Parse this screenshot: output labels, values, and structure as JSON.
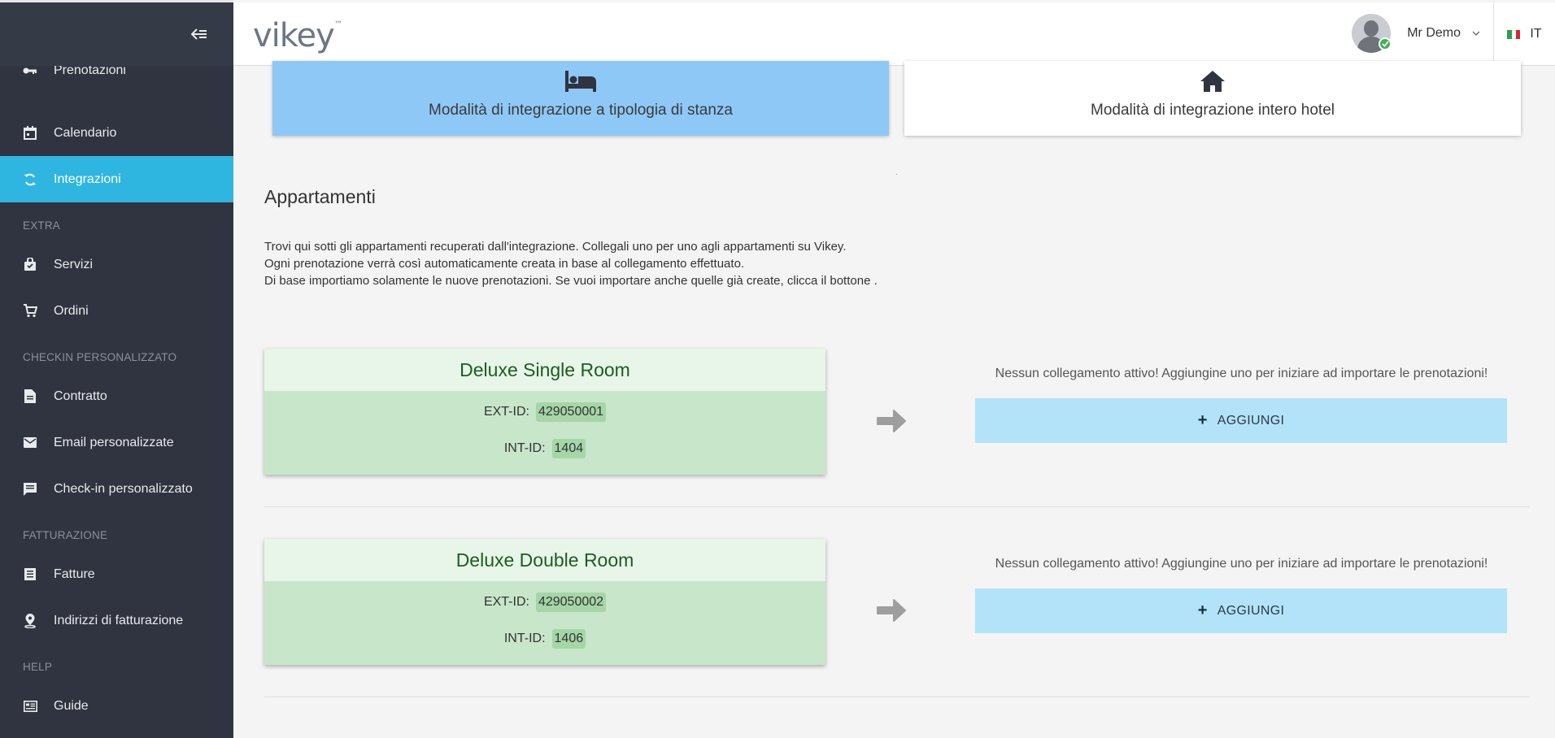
{
  "sidebar": {
    "items": [
      {
        "label": "Prenotazioni",
        "icon": "key-icon"
      },
      {
        "label": "Calendario",
        "icon": "calendar-icon"
      },
      {
        "label": "Integrazioni",
        "icon": "sync-icon",
        "active": true
      }
    ],
    "sections": [
      {
        "title": "EXTRA",
        "items": [
          {
            "label": "Servizi",
            "icon": "bag-icon"
          },
          {
            "label": "Ordini",
            "icon": "cart-icon"
          }
        ]
      },
      {
        "title": "CHECKIN PERSONALIZZATO",
        "items": [
          {
            "label": "Contratto",
            "icon": "document-icon"
          },
          {
            "label": "Email personalizzate",
            "icon": "mail-icon"
          },
          {
            "label": "Check-in personalizzato",
            "icon": "comment-icon"
          }
        ]
      },
      {
        "title": "FATTURAZIONE",
        "items": [
          {
            "label": "Fatture",
            "icon": "invoice-icon"
          },
          {
            "label": "Indirizzi di fatturazione",
            "icon": "location-icon"
          }
        ]
      },
      {
        "title": "HELP",
        "items": [
          {
            "label": "Guide",
            "icon": "guide-icon"
          }
        ]
      }
    ]
  },
  "header": {
    "logo": "vikey",
    "logo_tm": "™",
    "user_name": "Mr Demo",
    "lang": "IT"
  },
  "modes": {
    "room_type": "Modalità di integrazione a tipologia di stanza",
    "whole_hotel": "Modalità di integrazione intero hotel"
  },
  "section": {
    "title": "Appartamenti",
    "desc_lines": [
      "Trovi qui sotti gli appartamenti recuperati dall'integrazione. Collegali uno per uno agli appartamenti su Vikey.",
      "Ogni prenotazione verrà così automaticamente creata in base al collegamento effettuato.",
      "Di base importiamo solamente le nuove prenotazioni. Se vuoi importare anche quelle già create, clicca il bottone ."
    ]
  },
  "rooms": [
    {
      "name": "Deluxe Single Room",
      "ext_label": "EXT-ID:",
      "ext_id": "429050001",
      "int_label": "INT-ID:",
      "int_id": "1404",
      "status": "Nessun collegamento attivo! Aggiungine uno per iniziare ad importare le prenotazioni!",
      "button": "AGGIUNGI"
    },
    {
      "name": "Deluxe Double Room",
      "ext_label": "EXT-ID:",
      "ext_id": "429050002",
      "int_label": "INT-ID:",
      "int_id": "1406",
      "status": "Nessun collegamento attivo! Aggiungine uno per iniziare ad importare le prenotazioni!",
      "button": "AGGIUNGI"
    }
  ],
  "colors": {
    "sidebar_bg": "#2f3440",
    "active": "#2fb6e0",
    "mode_selected": "#8ec8f6",
    "room_card": "#c8e6c9",
    "add_button": "#b3e3f9"
  }
}
